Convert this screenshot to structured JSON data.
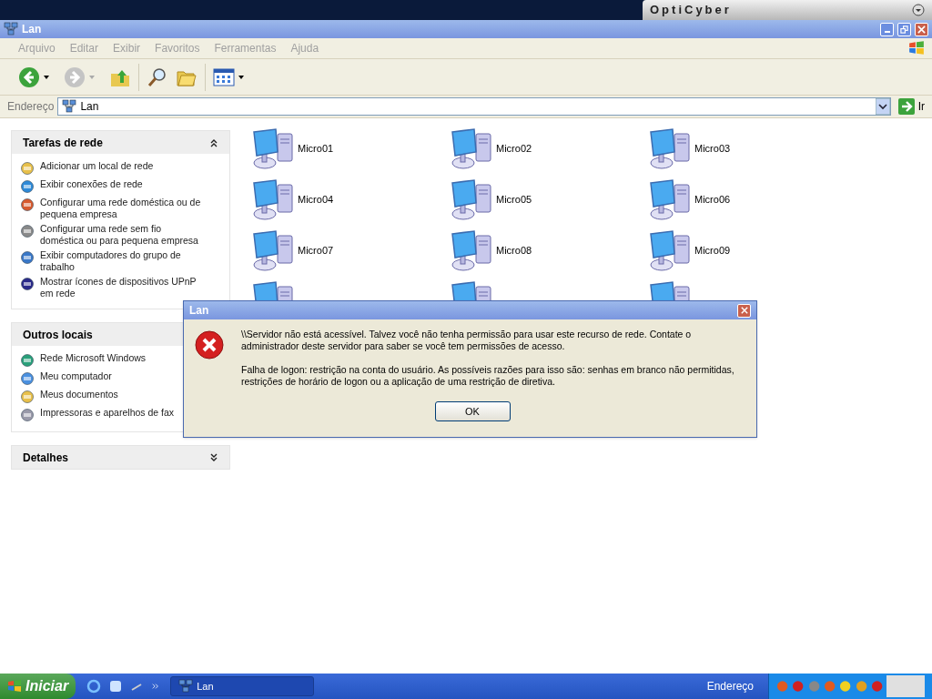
{
  "desktop_banner": {
    "text": "OptiCyber"
  },
  "window": {
    "title": "Lan"
  },
  "menu": [
    "Arquivo",
    "Editar",
    "Exibir",
    "Favoritos",
    "Ferramentas",
    "Ajuda"
  ],
  "address": {
    "label": "Endereço",
    "value": "Lan",
    "go": "Ir"
  },
  "panels": [
    {
      "title": "Tarefas de rede",
      "expanded": true,
      "items": [
        "Adicionar um local de rede",
        "Exibir conexões de rede",
        "Configurar uma rede doméstica ou de pequena empresa",
        "Configurar uma rede sem fio doméstica ou para pequena empresa",
        "Exibir computadores do grupo de trabalho",
        "Mostrar ícones de dispositivos UPnP em rede"
      ]
    },
    {
      "title": "Outros locais",
      "expanded": true,
      "items": [
        "Rede Microsoft Windows",
        "Meu computador",
        "Meus documentos",
        "Impressoras e aparelhos de fax"
      ]
    },
    {
      "title": "Detalhes",
      "expanded": false
    }
  ],
  "computers": [
    "Micro01",
    "Micro02",
    "Micro03",
    "Micro04",
    "Micro05",
    "Micro06",
    "Micro07",
    "Micro08",
    "Micro09"
  ],
  "dialog": {
    "title": "Lan",
    "paragraphs": [
      "\\\\Servidor não está acessível. Talvez você não tenha permissão para usar este recurso de rede. Contate o administrador deste servidor para saber se você tem permissões de acesso.",
      "Falha de logon: restrição na conta do usuário. As possíveis razões para isso são: senhas em branco não permitidas, restrições de horário de logon ou a aplicação de uma restrição de diretiva."
    ],
    "button": "OK"
  },
  "taskbar": {
    "start": "Iniciar",
    "tasks": [
      "Lan"
    ],
    "address_label": "Endereço"
  }
}
